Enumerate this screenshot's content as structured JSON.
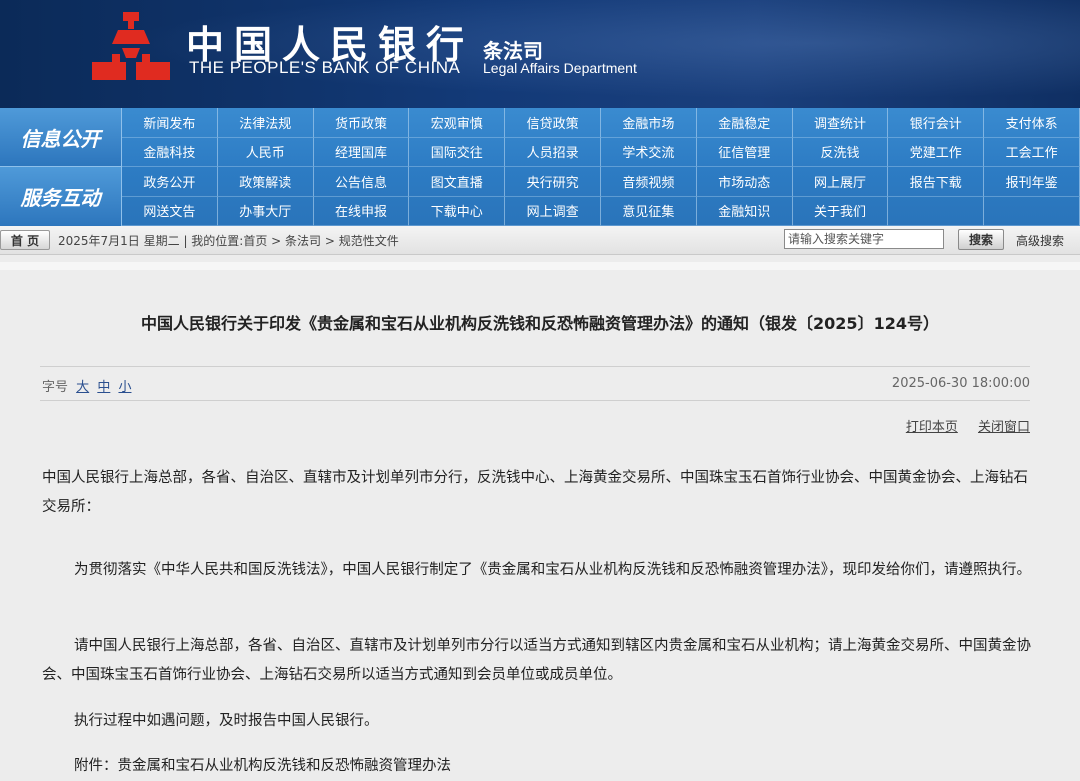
{
  "header": {
    "brand_cn": "中国人民银行",
    "brand_en": "THE PEOPLE'S BANK OF CHINA",
    "dept_cn": "条法司",
    "dept_en": "Legal Affairs Department",
    "logo_color": "#e02b20",
    "logo_icon": "pboc-emblem-icon"
  },
  "nav": {
    "side_labels": [
      "信息公开",
      "服务互动"
    ],
    "rows": [
      [
        "新闻发布",
        "法律法规",
        "货币政策",
        "宏观审慎",
        "信贷政策",
        "金融市场",
        "金融稳定",
        "调查统计",
        "银行会计",
        "支付体系"
      ],
      [
        "金融科技",
        "人民币",
        "经理国库",
        "国际交往",
        "人员招录",
        "学术交流",
        "征信管理",
        "反洗钱",
        "党建工作",
        "工会工作"
      ],
      [
        "政务公开",
        "政策解读",
        "公告信息",
        "图文直播",
        "央行研究",
        "音频视频",
        "市场动态",
        "网上展厅",
        "报告下载",
        "报刊年鉴"
      ],
      [
        "网送文告",
        "办事大厅",
        "在线申报",
        "下载中心",
        "网上调查",
        "意见征集",
        "金融知识",
        "关于我们",
        "",
        ""
      ]
    ]
  },
  "crumbbar": {
    "home_label": "首 页",
    "text": "2025年7月1日 星期二 | 我的位置:首页 > 条法司 > 规范性文件",
    "search_placeholder": "请输入搜索关键字",
    "search_button": "搜索",
    "advanced_search": "高级搜索"
  },
  "article": {
    "title": "中国人民银行关于印发《贵金属和宝石从业机构反洗钱和反恐怖融资管理办法》的通知（银发〔2025〕124号）",
    "font_size_label": "字号",
    "font_sizes": [
      "大",
      "中",
      "小"
    ],
    "date": "2025-06-30 18:00:00",
    "print_label": "打印本页",
    "close_label": "关闭窗口",
    "paragraphs": [
      "中国人民银行上海总部，各省、自治区、直辖市及计划单列市分行，反洗钱中心、上海黄金交易所、中国珠宝玉石首饰行业协会、中国黄金协会、上海钻石交易所：",
      "为贯彻落实《中华人民共和国反洗钱法》，中国人民银行制定了《贵金属和宝石从业机构反洗钱和反恐怖融资管理办法》，现印发给你们，请遵照执行。",
      "请中国人民银行上海总部，各省、自治区、直辖市及计划单列市分行以适当方式通知到辖区内贵金属和宝石从业机构；请上海黄金交易所、中国黄金协会、中国珠宝玉石首饰行业协会、上海钻石交易所以适当方式通知到会员单位或成员单位。",
      "执行过程中如遇问题，及时报告中国人民银行。",
      "附件：贵金属和宝石从业机构反洗钱和反恐怖融资管理办法"
    ]
  }
}
